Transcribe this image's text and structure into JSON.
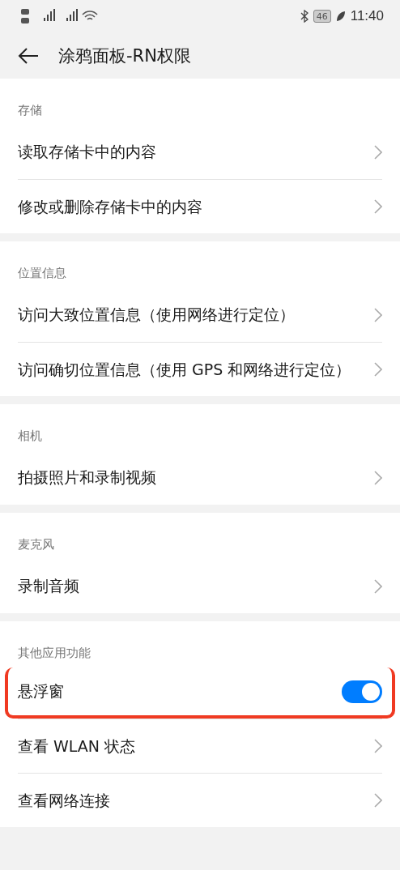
{
  "status_bar": {
    "battery": "46",
    "time": "11:40"
  },
  "header": {
    "title": "涂鸦面板-RN权限"
  },
  "sections": [
    {
      "title": "存储",
      "items": [
        {
          "kind": "link",
          "label": "读取存储卡中的内容"
        },
        {
          "kind": "link",
          "label": "修改或删除存储卡中的内容"
        }
      ]
    },
    {
      "title": "位置信息",
      "items": [
        {
          "kind": "link",
          "label": "访问大致位置信息（使用网络进行定位）"
        },
        {
          "kind": "link",
          "label": "访问确切位置信息（使用 GPS 和网络进行定位）"
        }
      ]
    },
    {
      "title": "相机",
      "items": [
        {
          "kind": "link",
          "label": "拍摄照片和录制视频"
        }
      ]
    },
    {
      "title": "麦克风",
      "items": [
        {
          "kind": "link",
          "label": "录制音频"
        }
      ]
    },
    {
      "title": "其他应用功能",
      "items": [
        {
          "kind": "toggle",
          "label": "悬浮窗",
          "on": true,
          "highlighted": true
        },
        {
          "kind": "link",
          "label": "查看 WLAN 状态"
        },
        {
          "kind": "link",
          "label": "查看网络连接"
        }
      ]
    }
  ]
}
